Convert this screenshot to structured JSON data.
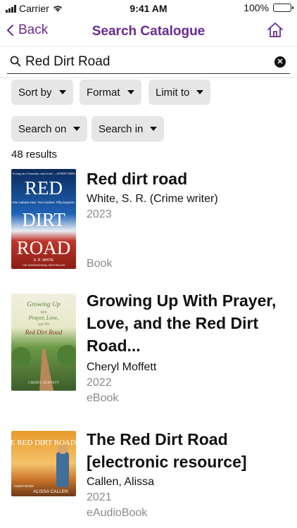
{
  "status": {
    "carrier": "Carrier",
    "time": "9:41 AM",
    "battery": "100%",
    "battery_level": 1.0
  },
  "nav": {
    "back_label": "Back",
    "title": "Search Catalogue",
    "home_icon": "home-icon"
  },
  "search": {
    "value": "Red Dirt Road"
  },
  "filters": {
    "sort_by": "Sort by",
    "format": "Format",
    "limit_to": "Limit to",
    "search_on": "Search on",
    "search_in": "Search in"
  },
  "results": {
    "count_text": "48 results",
    "items": [
      {
        "title": "Red dirt road",
        "author": "White, S. R. (Crime writer)",
        "year": "2023",
        "format": "Book",
        "cover": {
          "top_text": "'A rising star of Australian crime fiction' — SUNDAY TIMES",
          "lines": [
            "RED",
            "DIRT",
            "ROAD"
          ],
          "tagline": "One outback town. Two murders. Fifty suspects.",
          "author": "S. R. WHITE",
          "bottom": "THE INTERNATIONAL BESTSELLER"
        }
      },
      {
        "title": "Growing Up With Prayer, Love, and the Red Dirt Road...",
        "author": "Cheryl Moffett",
        "year": "2022",
        "format": "eBook",
        "cover": {
          "line1": "Growing Up",
          "line2": "With",
          "line3": "Prayer, Love,",
          "line4": "and The",
          "line5": "Red Dirt Road",
          "author": "CHERYL MOFFETT"
        }
      },
      {
        "title": "The Red Dirt Road [electronic resource]",
        "author": "Callen, Alissa",
        "year": "2021",
        "format": "eAudioBook",
        "cover": {
          "title": "THE RED DIRT ROAD",
          "author": "ALISSA CALLEN",
          "badge": "AUDIO BOOK"
        }
      }
    ]
  }
}
